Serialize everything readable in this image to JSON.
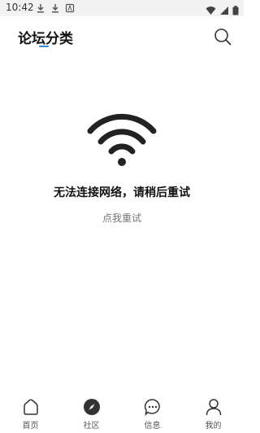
{
  "status_bar": {
    "time": "10:42",
    "left_icons": [
      "download-icon",
      "download-icon",
      "app-icon"
    ],
    "right_icons": [
      "wifi-icon",
      "signal-icon",
      "battery-icon"
    ]
  },
  "header": {
    "title": "论坛分类",
    "accent_color": "#2e8cd8",
    "search_icon": "search-icon"
  },
  "error": {
    "icon": "wifi-icon",
    "message": "无法连接网络，请稍后重试",
    "retry_label": "点我重试"
  },
  "bottom_nav": {
    "items": [
      {
        "label": "首页",
        "icon": "home-icon"
      },
      {
        "label": "社区",
        "icon": "compass-icon"
      },
      {
        "label": "信息",
        "icon": "message-icon"
      },
      {
        "label": "我的",
        "icon": "user-icon"
      }
    ]
  }
}
